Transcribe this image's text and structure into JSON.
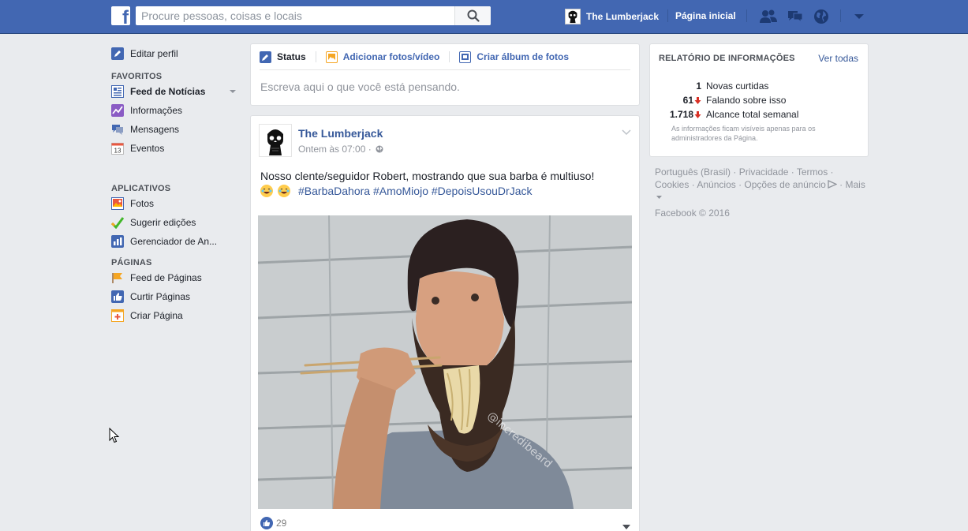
{
  "topbar": {
    "search_placeholder": "Procure pessoas, coisas e locais",
    "user_name": "The Lumberjack",
    "home_label": "Página inicial",
    "icons": [
      "friend-requests-icon",
      "messages-icon",
      "notifications-globe-icon",
      "account-dropdown-icon"
    ]
  },
  "leftnav": {
    "edit_profile": "Editar perfil",
    "favorites_heading": "FAVORITOS",
    "favorites": [
      {
        "label": "Feed de Notícias",
        "icon": "news-feed-icon"
      },
      {
        "label": "Informações",
        "icon": "insights-icon"
      },
      {
        "label": "Mensagens",
        "icon": "messages-icon"
      },
      {
        "label": "Eventos",
        "icon": "calendar-icon",
        "badge": "13"
      }
    ],
    "apps_heading": "APLICATIVOS",
    "apps": [
      {
        "label": "Fotos",
        "icon": "photos-icon"
      },
      {
        "label": "Sugerir edições",
        "icon": "checkmark-icon"
      },
      {
        "label": "Gerenciador de An...",
        "icon": "ads-manager-icon"
      }
    ],
    "pages_heading": "PÁGINAS",
    "pages": [
      {
        "label": "Feed de Páginas",
        "icon": "pages-feed-icon"
      },
      {
        "label": "Curtir Páginas",
        "icon": "thumbs-up-icon"
      },
      {
        "label": "Criar Página",
        "icon": "create-page-icon"
      }
    ]
  },
  "composer": {
    "tab_status": "Status",
    "tab_photos": "Adicionar fotos/vídeo",
    "tab_album": "Criar álbum de fotos",
    "placeholder": "Escreva aqui o que você está pensando."
  },
  "post": {
    "author": "The Lumberjack",
    "time": "Ontem às 07:00 ·",
    "text": "Nosso clente/seguidor Robert, mostrando que sua barba é multiuso!",
    "hashtags": "#BarbaDahora #AmoMiojo #DepoisUsouDrJack",
    "image_watermark": "@incredibeard",
    "likes": "29"
  },
  "insights": {
    "heading": "RELATÓRIO DE INFORMAÇÕES",
    "see_all": "Ver todas",
    "rows": [
      {
        "value": "1",
        "label": "Novas curtidas",
        "trend": "none"
      },
      {
        "value": "61",
        "label": "Falando sobre isso",
        "trend": "down"
      },
      {
        "value": "1.718",
        "label": "Alcance total semanal",
        "trend": "down"
      }
    ],
    "note": "As informações ficam visíveis apenas para os administradores da Página."
  },
  "footer": {
    "links": [
      "Português (Brasil)",
      "Privacidade",
      "Termos",
      "Cookies",
      "Anúncios",
      "Opções de anúncio",
      "Mais"
    ],
    "copyright": "Facebook © 2016"
  },
  "colors": {
    "brand_blue": "#4267b2",
    "link_blue": "#365899",
    "background": "#e9ebee",
    "trend_down": "#d93025"
  }
}
